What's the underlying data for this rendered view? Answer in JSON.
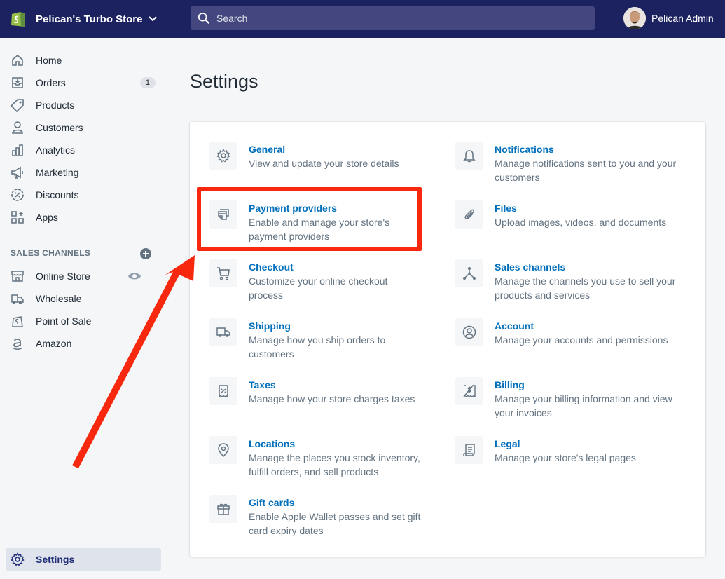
{
  "topbar": {
    "store_name": "Pelican's Turbo Store",
    "search_placeholder": "Search",
    "user_name": "Pelican Admin"
  },
  "sidebar": {
    "items": [
      {
        "label": "Home",
        "icon": "home-icon"
      },
      {
        "label": "Orders",
        "icon": "orders-icon",
        "badge": "1"
      },
      {
        "label": "Products",
        "icon": "tag-icon"
      },
      {
        "label": "Customers",
        "icon": "person-icon"
      },
      {
        "label": "Analytics",
        "icon": "analytics-icon"
      },
      {
        "label": "Marketing",
        "icon": "megaphone-icon"
      },
      {
        "label": "Discounts",
        "icon": "discount-icon"
      },
      {
        "label": "Apps",
        "icon": "apps-icon"
      }
    ],
    "section_label": "SALES CHANNELS",
    "channels": [
      {
        "label": "Online Store",
        "icon": "store-icon"
      },
      {
        "label": "Wholesale",
        "icon": "wholesale-icon"
      },
      {
        "label": "Point of Sale",
        "icon": "pos-icon"
      },
      {
        "label": "Amazon",
        "icon": "amazon-icon"
      }
    ],
    "settings_label": "Settings"
  },
  "main": {
    "title": "Settings",
    "left": [
      {
        "title": "General",
        "desc": [
          "View and update your store details"
        ]
      },
      {
        "title": "Payment providers",
        "desc": [
          "Enable and manage your store's",
          "payment providers"
        ]
      },
      {
        "title": "Checkout",
        "desc": [
          "Customize your online checkout",
          "process"
        ]
      },
      {
        "title": "Shipping",
        "desc": [
          "Manage how you ship orders to",
          "customers"
        ]
      },
      {
        "title": "Taxes",
        "desc": [
          "Manage how your store charges taxes"
        ]
      },
      {
        "title": "Locations",
        "desc": [
          "Manage the places you stock inventory,",
          "fulfill orders, and sell products"
        ]
      },
      {
        "title": "Gift cards",
        "desc": [
          "Enable Apple Wallet passes and set gift",
          "card expiry dates"
        ]
      }
    ],
    "right": [
      {
        "title": "Notifications",
        "desc": [
          "Manage notifications sent to you and your",
          "customers"
        ]
      },
      {
        "title": "Files",
        "desc": [
          "Upload images, videos, and documents"
        ]
      },
      {
        "title": "Sales channels",
        "desc": [
          "Manage the channels you use to sell your",
          "products and services"
        ]
      },
      {
        "title": "Account",
        "desc": [
          "Manage your accounts and permissions"
        ]
      },
      {
        "title": "Billing",
        "desc": [
          "Manage your billing information and view",
          "your invoices"
        ]
      },
      {
        "title": "Legal",
        "desc": [
          "Manage your store's legal pages"
        ]
      }
    ]
  },
  "colors": {
    "topbar": "#1c2260",
    "link": "#006fbb",
    "annotation": "#f7280e"
  }
}
